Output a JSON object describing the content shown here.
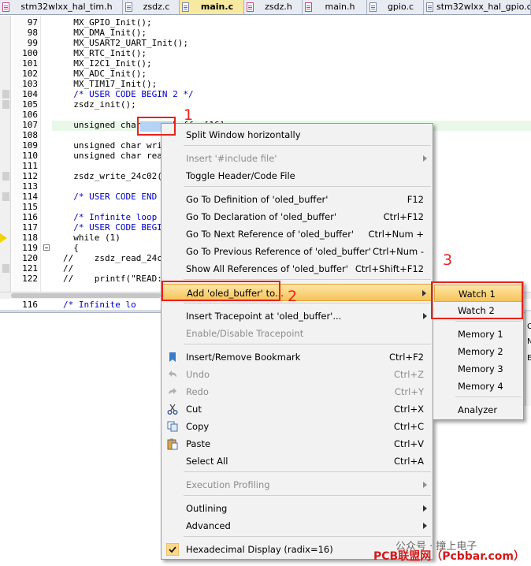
{
  "tabs": [
    {
      "label": "stm32wlxx_hal_tim.h",
      "type": "h"
    },
    {
      "label": "zsdz.c",
      "type": "c"
    },
    {
      "label": "main.c",
      "type": "c",
      "active": true
    },
    {
      "label": "zsdz.h",
      "type": "h"
    },
    {
      "label": "main.h",
      "type": "h"
    },
    {
      "label": "gpio.c",
      "type": "c"
    },
    {
      "label": "stm32wlxx_hal_gpio.c",
      "type": "c"
    }
  ],
  "editor": {
    "lines": [
      {
        "n": "97",
        "text": "  MX_GPIO_Init();"
      },
      {
        "n": "98",
        "text": "  MX_DMA_Init();"
      },
      {
        "n": "99",
        "text": "  MX_USART2_UART_Init();"
      },
      {
        "n": "100",
        "text": "  MX_RTC_Init();"
      },
      {
        "n": "101",
        "text": "  MX_I2C1_Init();"
      },
      {
        "n": "102",
        "text": "  MX_ADC_Init();"
      },
      {
        "n": "103",
        "text": "  MX_TIM17_Init();"
      },
      {
        "n": "104",
        "text": "  /* USER CODE BEGIN 2 */"
      },
      {
        "n": "105",
        "text": "  zsdz_init();"
      },
      {
        "n": "106",
        "text": ""
      },
      {
        "n": "107",
        "text": "  unsigned char oled_buffer[16]"
      },
      {
        "n": "108",
        "text": ""
      },
      {
        "n": "109",
        "text": "  unsigned char writ"
      },
      {
        "n": "110",
        "text": "  unsigned char read"
      },
      {
        "n": "111",
        "text": ""
      },
      {
        "n": "112",
        "text": "  zsdz_write_24c02(0"
      },
      {
        "n": "113",
        "text": ""
      },
      {
        "n": "114",
        "text": "  /* USER CODE END 2"
      },
      {
        "n": "115",
        "text": ""
      },
      {
        "n": "116",
        "text": "  /* Infinite loop *"
      },
      {
        "n": "117",
        "text": "  /* USER CODE BEGIN"
      },
      {
        "n": "118",
        "text": "  while (1)"
      },
      {
        "n": "119",
        "text": "  {"
      },
      {
        "n": "120",
        "text": "//    zsdz_read_24c0"
      },
      {
        "n": "121",
        "text": "//"
      },
      {
        "n": "122",
        "text": "//    printf(\"READ:%"
      }
    ],
    "split_line": {
      "n": "116",
      "text": "/* Infinite lo"
    }
  },
  "context_menu": {
    "items": [
      {
        "label": "Split Window horizontally",
        "shortcut": "",
        "enabled": true
      },
      {
        "label": "Insert '#include file'",
        "shortcut": "",
        "enabled": false,
        "submenu": true
      },
      {
        "label": "Toggle Header/Code File",
        "shortcut": "",
        "enabled": true
      },
      {
        "label": "Go To Definition of 'oled_buffer'",
        "shortcut": "F12",
        "enabled": true
      },
      {
        "label": "Go To Declaration of 'oled_buffer'",
        "shortcut": "Ctrl+F12",
        "enabled": true
      },
      {
        "label": "Go To Next Reference of 'oled_buffer'",
        "shortcut": "Ctrl+Num +",
        "enabled": true
      },
      {
        "label": "Go To Previous Reference of 'oled_buffer'",
        "shortcut": "Ctrl+Num -",
        "enabled": true
      },
      {
        "label": "Show All References of 'oled_buffer'",
        "shortcut": "Ctrl+Shift+F12",
        "enabled": true
      },
      {
        "label": "Add 'oled_buffer' to...",
        "shortcut": "",
        "enabled": true,
        "submenu": true,
        "highlighted": true
      },
      {
        "label": "Insert Tracepoint at 'oled_buffer'...",
        "shortcut": "",
        "enabled": true,
        "submenu": true
      },
      {
        "label": "Enable/Disable Tracepoint",
        "shortcut": "",
        "enabled": false
      },
      {
        "label": "Insert/Remove Bookmark",
        "shortcut": "Ctrl+F2",
        "enabled": true,
        "icon": "bookmark-icon"
      },
      {
        "label": "Undo",
        "shortcut": "Ctrl+Z",
        "enabled": false,
        "icon": "undo-icon"
      },
      {
        "label": "Redo",
        "shortcut": "Ctrl+Y",
        "enabled": false,
        "icon": "redo-icon"
      },
      {
        "label": "Cut",
        "shortcut": "Ctrl+X",
        "enabled": true,
        "icon": "scissors-icon"
      },
      {
        "label": "Copy",
        "shortcut": "Ctrl+C",
        "enabled": true,
        "icon": "copy-icon"
      },
      {
        "label": "Paste",
        "shortcut": "Ctrl+V",
        "enabled": true,
        "icon": "paste-icon"
      },
      {
        "label": "Select All",
        "shortcut": "Ctrl+A",
        "enabled": true
      },
      {
        "label": "Execution Profiling",
        "shortcut": "",
        "enabled": false,
        "submenu": true
      },
      {
        "label": "Outlining",
        "shortcut": "",
        "enabled": true,
        "submenu": true
      },
      {
        "label": "Advanced",
        "shortcut": "",
        "enabled": true,
        "submenu": true
      },
      {
        "label": "Hexadecimal Display (radix=16)",
        "shortcut": "",
        "enabled": true,
        "checked": true
      }
    ]
  },
  "submenu": {
    "items": [
      {
        "label": "Watch 1",
        "highlighted": true
      },
      {
        "label": "Watch 2"
      },
      {
        "label": "Memory 1"
      },
      {
        "label": "Memory 2"
      },
      {
        "label": "Memory 3"
      },
      {
        "label": "Memory 4"
      },
      {
        "label": "Analyzer"
      }
    ]
  },
  "annotations": {
    "step1": "1",
    "step2": "2",
    "step3": "3",
    "color": "#e8221b"
  },
  "watermark": {
    "line1": "公众号 · 撞上电子",
    "line2": "PCB联盟网（Pcbbar.com）"
  },
  "side_pane": {
    "chars": [
      "Ca",
      "N",
      "E"
    ]
  },
  "colors": {
    "menu_bg": "#f2f2f2",
    "highlight": "#f6c35a",
    "active_tab": "#f7e9a0",
    "keyword": "#0000c8",
    "selection": "#b5d3f3"
  }
}
